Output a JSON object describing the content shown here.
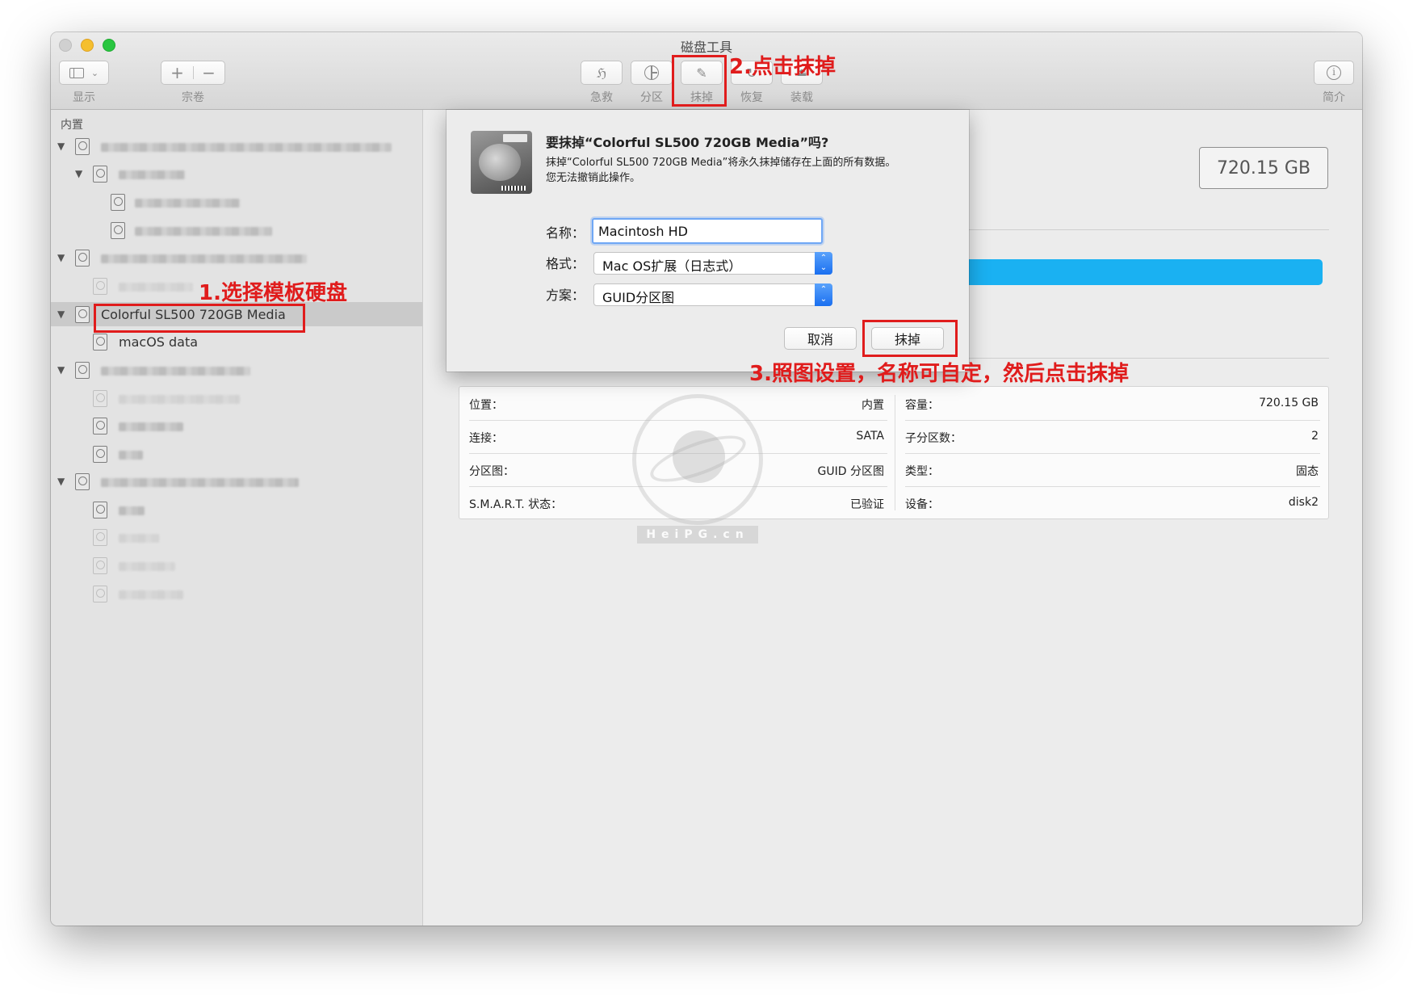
{
  "window": {
    "title": "磁盘工具"
  },
  "toolbar": {
    "view_label": "显示",
    "volume_label": "宗卷",
    "volume_add": "+",
    "volume_remove": "−",
    "firstaid_label": "急救",
    "partition_label": "分区",
    "erase_label": "抹掉",
    "restore_label": "恢复",
    "mount_label": "装载",
    "info_label": "简介"
  },
  "sidebar": {
    "header": "内置",
    "selected_disk": "Colorful SL500 720GB Media",
    "selected_volume": "macOS data"
  },
  "main": {
    "capacity": "720.15 GB",
    "info": {
      "location_label": "位置：",
      "location_value": "内置",
      "connection_label": "连接：",
      "connection_value": "SATA",
      "partition_map_label": "分区图：",
      "partition_map_value": "GUID 分区图",
      "smart_label": "S.M.A.R.T. 状态：",
      "smart_value": "已验证",
      "capacity_label": "容量：",
      "capacity_value": "720.15 GB",
      "child_count_label": "子分区数：",
      "child_count_value": "2",
      "type_label": "类型：",
      "type_value": "固态",
      "device_label": "设备：",
      "device_value": "disk2"
    },
    "watermark": "HeiPG.cn"
  },
  "dialog": {
    "title": "要抹掉“Colorful SL500 720GB Media”吗?",
    "message_line1": "抹掉“Colorful SL500 720GB Media”将永久抹掉储存在上面的所有数据。",
    "message_line2": "您无法撤销此操作。",
    "name_label": "名称：",
    "name_value": "Macintosh HD",
    "format_label": "格式：",
    "format_value": "Mac OS扩展（日志式）",
    "scheme_label": "方案：",
    "scheme_value": "GUID分区图",
    "cancel_label": "取消",
    "erase_label": "抹掉"
  },
  "annotations": {
    "step1": "1.选择模板硬盘",
    "step2": "2.点击抹掉",
    "step3": "3.照图设置，名称可自定，然后点击抹掉"
  },
  "colors": {
    "annotation_red": "#e01c1c",
    "usage_bar": "#1ab1f2",
    "focus_blue": "#6fa7f5",
    "select_arrow_blue": "#1a6ff0"
  }
}
